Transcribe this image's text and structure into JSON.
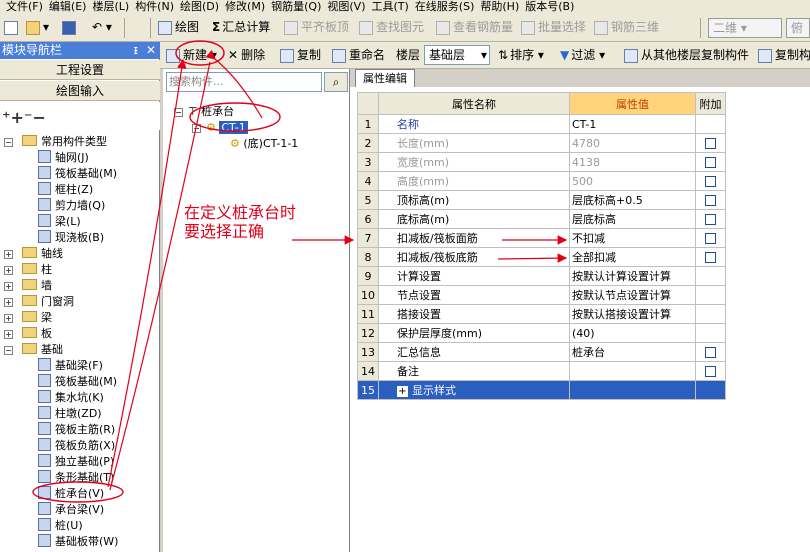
{
  "menubar": [
    "文件(F)",
    "编辑(E)",
    "楼层(L)",
    "构件(N)",
    "绘图(D)",
    "修改(M)",
    "钢筋量(Q)",
    "视图(V)",
    "工具(T)",
    "在线服务(S)",
    "帮助(H)",
    "版本号(B)"
  ],
  "toolbar1": {
    "draw": "绘图",
    "summary": "汇总计算",
    "flat_plate": "平齐板顶",
    "find_drawing": "查找图元",
    "view_rebar": "查看钢筋量",
    "batch_select": "批量选择",
    "rebar_3d": "钢筋三维",
    "view_mode": "二维",
    "view_mode2": "俯视"
  },
  "left_panel": {
    "title": "模块导航栏",
    "pin": "ᵻ",
    "btn_project": "工程设置",
    "btn_draw": "绘图输入",
    "tree": [
      {
        "label": "常用构件类型",
        "level": 0,
        "type": "folder",
        "exp": "-"
      },
      {
        "label": "轴网(J)",
        "level": 1
      },
      {
        "label": "筏板基础(M)",
        "level": 1
      },
      {
        "label": "框柱(Z)",
        "level": 1
      },
      {
        "label": "剪力墙(Q)",
        "level": 1
      },
      {
        "label": "梁(L)",
        "level": 1
      },
      {
        "label": "现浇板(B)",
        "level": 1
      },
      {
        "label": "轴线",
        "level": 0,
        "type": "folder",
        "exp": "+"
      },
      {
        "label": "柱",
        "level": 0,
        "type": "folder",
        "exp": "+"
      },
      {
        "label": "墙",
        "level": 0,
        "type": "folder",
        "exp": "+"
      },
      {
        "label": "门窗洞",
        "level": 0,
        "type": "folder",
        "exp": "+"
      },
      {
        "label": "梁",
        "level": 0,
        "type": "folder",
        "exp": "+"
      },
      {
        "label": "板",
        "level": 0,
        "type": "folder",
        "exp": "+"
      },
      {
        "label": "基础",
        "level": 0,
        "type": "folder",
        "exp": "-"
      },
      {
        "label": "基础梁(F)",
        "level": 1
      },
      {
        "label": "筏板基础(M)",
        "level": 1
      },
      {
        "label": "集水坑(K)",
        "level": 1
      },
      {
        "label": "柱墩(ZD)",
        "level": 1
      },
      {
        "label": "筏板主筋(R)",
        "level": 1
      },
      {
        "label": "筏板负筋(X)",
        "level": 1
      },
      {
        "label": "独立基础(P)",
        "level": 1
      },
      {
        "label": "条形基础(T)",
        "level": 1
      },
      {
        "label": "桩承台(V)",
        "level": 1
      },
      {
        "label": "承台梁(V)",
        "level": 1
      },
      {
        "label": "桩(U)",
        "level": 1
      },
      {
        "label": "基础板带(W)",
        "level": 1
      }
    ]
  },
  "toolbar2": {
    "new": "新建",
    "delete": "删除",
    "copy": "复制",
    "rename": "重命名",
    "floor_label": "楼层",
    "floor_value": "基础层",
    "sort": "排序",
    "filter": "过滤",
    "copy_from_floor": "从其他楼层复制构件",
    "copy_to": "复制构"
  },
  "mid_panel": {
    "search_placeholder": "搜索构件...",
    "root": "桩承台",
    "child": "CT-1",
    "grandchild": "(底)CT-1-1"
  },
  "right_panel": {
    "tab": "属性编辑",
    "col_name": "属性名称",
    "col_value": "属性值",
    "col_add": "附加",
    "rows": [
      {
        "idx": "1",
        "name": "名称",
        "value": "CT-1",
        "check": false,
        "style": "blue"
      },
      {
        "idx": "2",
        "name": "长度(mm)",
        "value": "4780",
        "check": true,
        "style": "gray"
      },
      {
        "idx": "3",
        "name": "宽度(mm)",
        "value": "4138",
        "check": true,
        "style": "gray"
      },
      {
        "idx": "4",
        "name": "高度(mm)",
        "value": "500",
        "check": true,
        "style": "gray"
      },
      {
        "idx": "5",
        "name": "顶标高(m)",
        "value": "层底标高+0.5",
        "check": true,
        "style": ""
      },
      {
        "idx": "6",
        "name": "底标高(m)",
        "value": "层底标高",
        "check": true,
        "style": ""
      },
      {
        "idx": "7",
        "name": "扣减板/筏板面筋",
        "value": "不扣减",
        "check": true,
        "style": ""
      },
      {
        "idx": "8",
        "name": "扣减板/筏板底筋",
        "value": "全部扣减",
        "check": true,
        "style": ""
      },
      {
        "idx": "9",
        "name": "计算设置",
        "value": "按默认计算设置计算",
        "check": false,
        "style": ""
      },
      {
        "idx": "10",
        "name": "节点设置",
        "value": "按默认节点设置计算",
        "check": false,
        "style": ""
      },
      {
        "idx": "11",
        "name": "搭接设置",
        "value": "按默认搭接设置计算",
        "check": false,
        "style": ""
      },
      {
        "idx": "12",
        "name": "保护层厚度(mm)",
        "value": "(40)",
        "check": false,
        "style": ""
      },
      {
        "idx": "13",
        "name": "汇总信息",
        "value": "桩承台",
        "check": true,
        "style": ""
      },
      {
        "idx": "14",
        "name": "备注",
        "value": "",
        "check": true,
        "style": ""
      },
      {
        "idx": "15",
        "name": "显示样式",
        "value": "",
        "check": false,
        "style": "selected"
      }
    ]
  },
  "annotation": {
    "line1": "在定义桩承台时",
    "line2": "要选择正确"
  },
  "colors": {
    "accent": "#2a5fc0",
    "annotation": "#e0001c",
    "header_value": "#ffd47a"
  }
}
